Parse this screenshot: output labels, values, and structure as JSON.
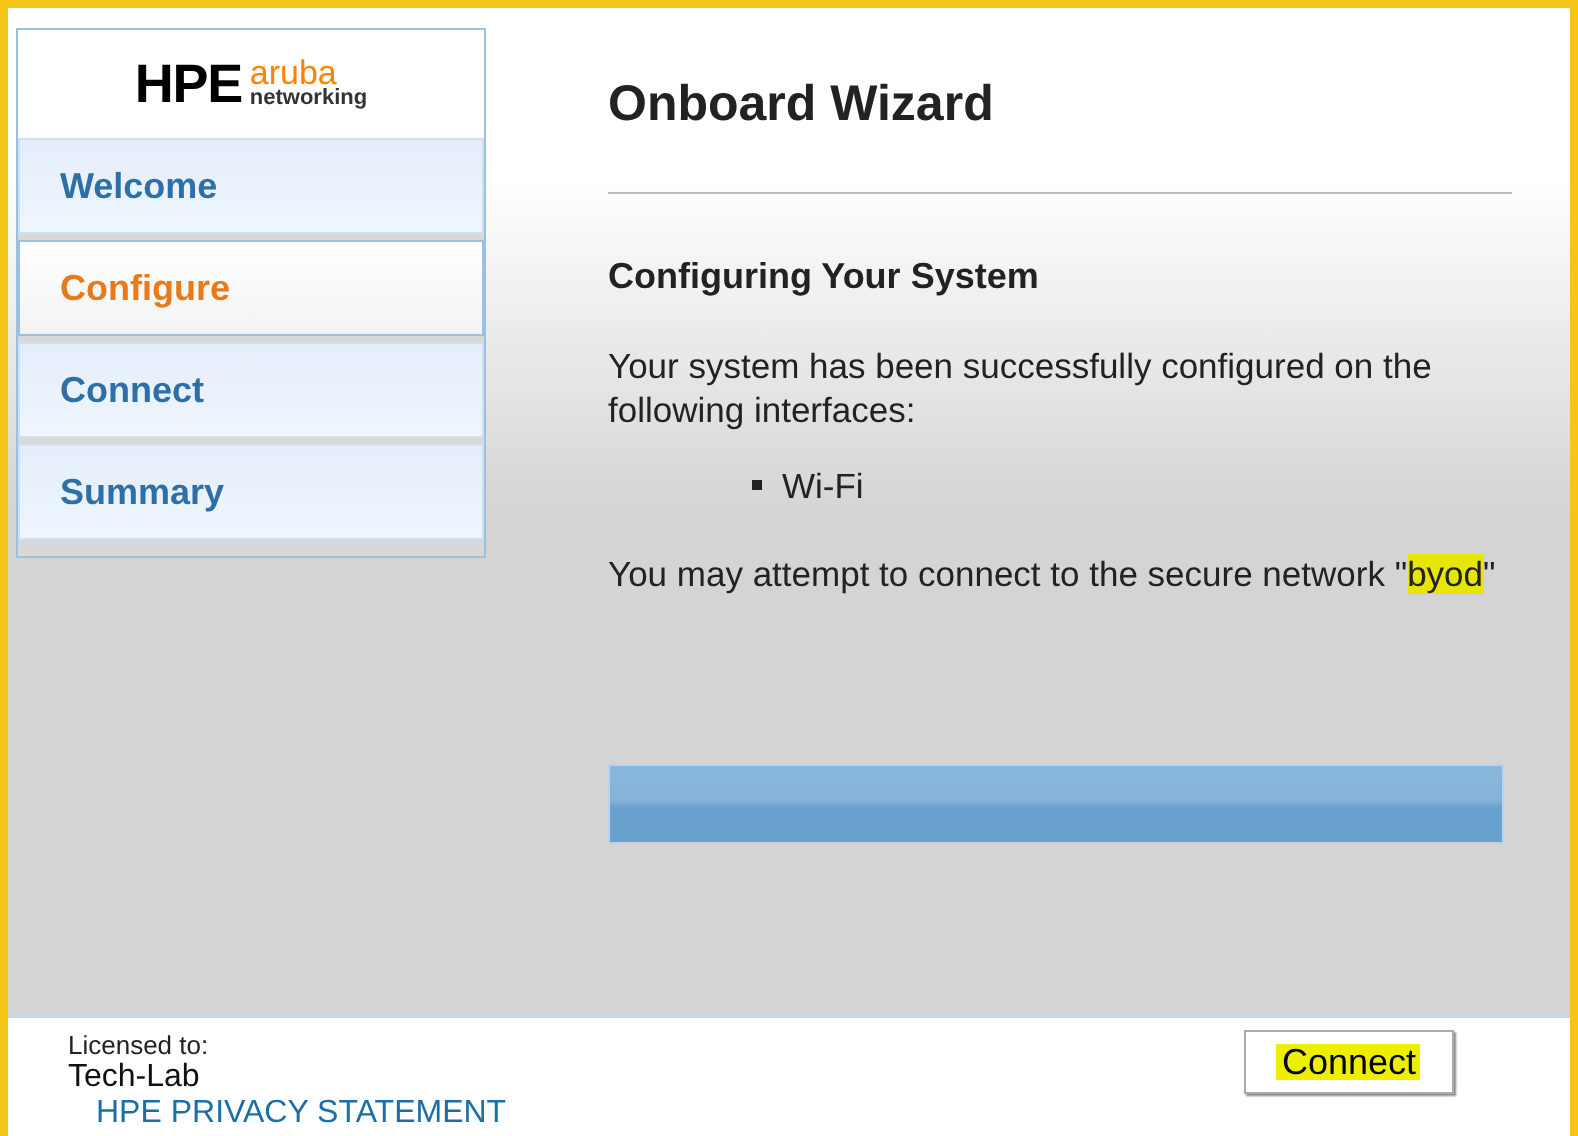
{
  "logo": {
    "brand": "HPE",
    "product": "aruba",
    "subtitle": "networking"
  },
  "nav": [
    {
      "label": "Welcome",
      "selected": false
    },
    {
      "label": "Configure",
      "selected": true
    },
    {
      "label": "Connect",
      "selected": false
    },
    {
      "label": "Summary",
      "selected": false
    }
  ],
  "title": "Onboard Wizard",
  "section_title": "Configuring Your System",
  "message": "Your system has been successfully configured on the following interfaces:",
  "interfaces": [
    "Wi-Fi"
  ],
  "network_prompt": {
    "text": "You may attempt to connect to the secure network",
    "quote_open": "\"",
    "network": "byod",
    "quote_close": "\"",
    "highlighted": true
  },
  "progress": {
    "level": 1
  },
  "footer": {
    "licensed_label": "Licensed to:",
    "licensee": "Tech-Lab",
    "privacy_link": "HPE PRIVACY STATEMENT"
  },
  "connect_button": {
    "label": "Connect",
    "highlighted": true
  }
}
